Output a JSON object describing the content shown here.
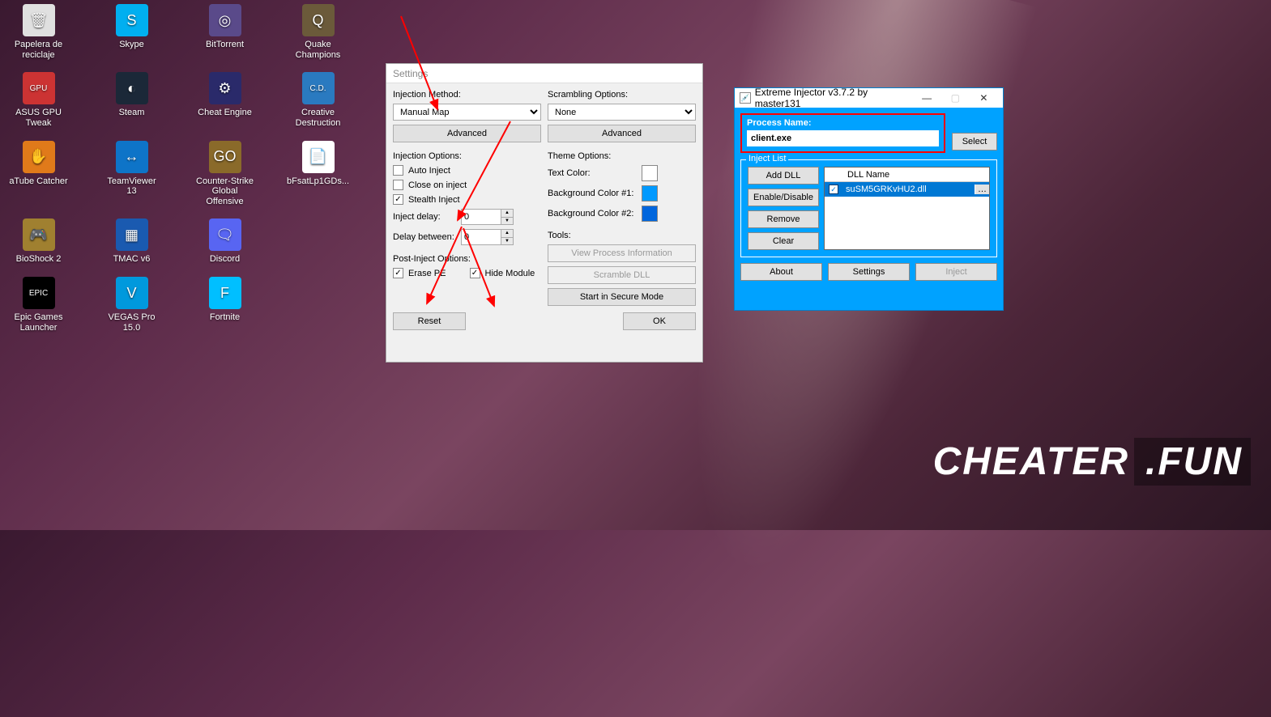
{
  "desktop": {
    "icons": [
      [
        {
          "label": "Papelera de reciclaje",
          "color": "#e0e0e0",
          "glyph": "🗑"
        },
        {
          "label": "Skype",
          "color": "#00aff0",
          "glyph": "S"
        },
        {
          "label": "BitTorrent",
          "color": "#5a4a8a",
          "glyph": "◎"
        },
        {
          "label": "Quake Champions",
          "color": "#6b5a3a",
          "glyph": "Q"
        }
      ],
      [
        {
          "label": "ASUS GPU Tweak",
          "color": "#cc3333",
          "glyph": "GPU"
        },
        {
          "label": "Steam",
          "color": "#1b2838",
          "glyph": "◐"
        },
        {
          "label": "Cheat Engine",
          "color": "#2a2a6a",
          "glyph": "⚙"
        },
        {
          "label": "Creative Destruction",
          "color": "#2a7ac0",
          "glyph": "C.D."
        }
      ],
      [
        {
          "label": "aTube Catcher",
          "color": "#e07a1a",
          "glyph": "✋"
        },
        {
          "label": "TeamViewer 13",
          "color": "#0e74c8",
          "glyph": "↔"
        },
        {
          "label": "Counter-Strike Global Offensive",
          "color": "#8a6a2a",
          "glyph": "GO"
        },
        {
          "label": "bFsatLp1GDs...",
          "color": "#ffffff",
          "glyph": "📄"
        }
      ],
      [
        {
          "label": "BioShock 2",
          "color": "#a08030",
          "glyph": "🎮"
        },
        {
          "label": "TMAC v6",
          "color": "#1a5ab0",
          "glyph": "▦"
        },
        {
          "label": "Discord",
          "color": "#5865f2",
          "glyph": "🗨"
        }
      ],
      [
        {
          "label": "Epic Games Launcher",
          "color": "#000000",
          "glyph": "EPIC"
        },
        {
          "label": "VEGAS Pro 15.0",
          "color": "#0099dd",
          "glyph": "V"
        },
        {
          "label": "Fortnite",
          "color": "#00bfff",
          "glyph": "F"
        }
      ]
    ]
  },
  "settings": {
    "title": "Settings",
    "injection_method_label": "Injection Method:",
    "injection_method_value": "Manual Map",
    "advanced_btn": "Advanced",
    "injection_options_label": "Injection Options:",
    "auto_inject": "Auto Inject",
    "close_on_inject": "Close on inject",
    "stealth_inject": "Stealth Inject",
    "inject_delay_label": "Inject delay:",
    "inject_delay_value": "0",
    "delay_between_label": "Delay between:",
    "delay_between_value": "0",
    "post_inject_label": "Post-Inject Options:",
    "erase_pe": "Erase PE",
    "hide_module": "Hide Module",
    "scrambling_label": "Scrambling Options:",
    "scrambling_value": "None",
    "theme_label": "Theme Options:",
    "text_color_label": "Text Color:",
    "text_color": "#ffffff",
    "bg1_label": "Background Color #1:",
    "bg1": "#0099ff",
    "bg2_label": "Background Color #2:",
    "bg2": "#0066dd",
    "tools_label": "Tools:",
    "view_proc": "View Process Information",
    "scramble_dll": "Scramble DLL",
    "secure_mode": "Start in Secure Mode",
    "reset": "Reset",
    "ok": "OK"
  },
  "injector": {
    "title": "Extreme Injector v3.7.2 by master131",
    "process_label": "Process Name:",
    "process_value": "client.exe",
    "select_btn": "Select",
    "inject_list_label": "Inject List",
    "add_dll": "Add DLL",
    "enable_disable": "Enable/Disable",
    "remove": "Remove",
    "clear": "Clear",
    "dll_header": "DLL Name",
    "dll_item": "suSM5GRKvHU2.dll",
    "about": "About",
    "settings": "Settings",
    "inject": "Inject"
  },
  "watermark": {
    "t1": "CHEATER",
    "t2": ".FUN"
  }
}
